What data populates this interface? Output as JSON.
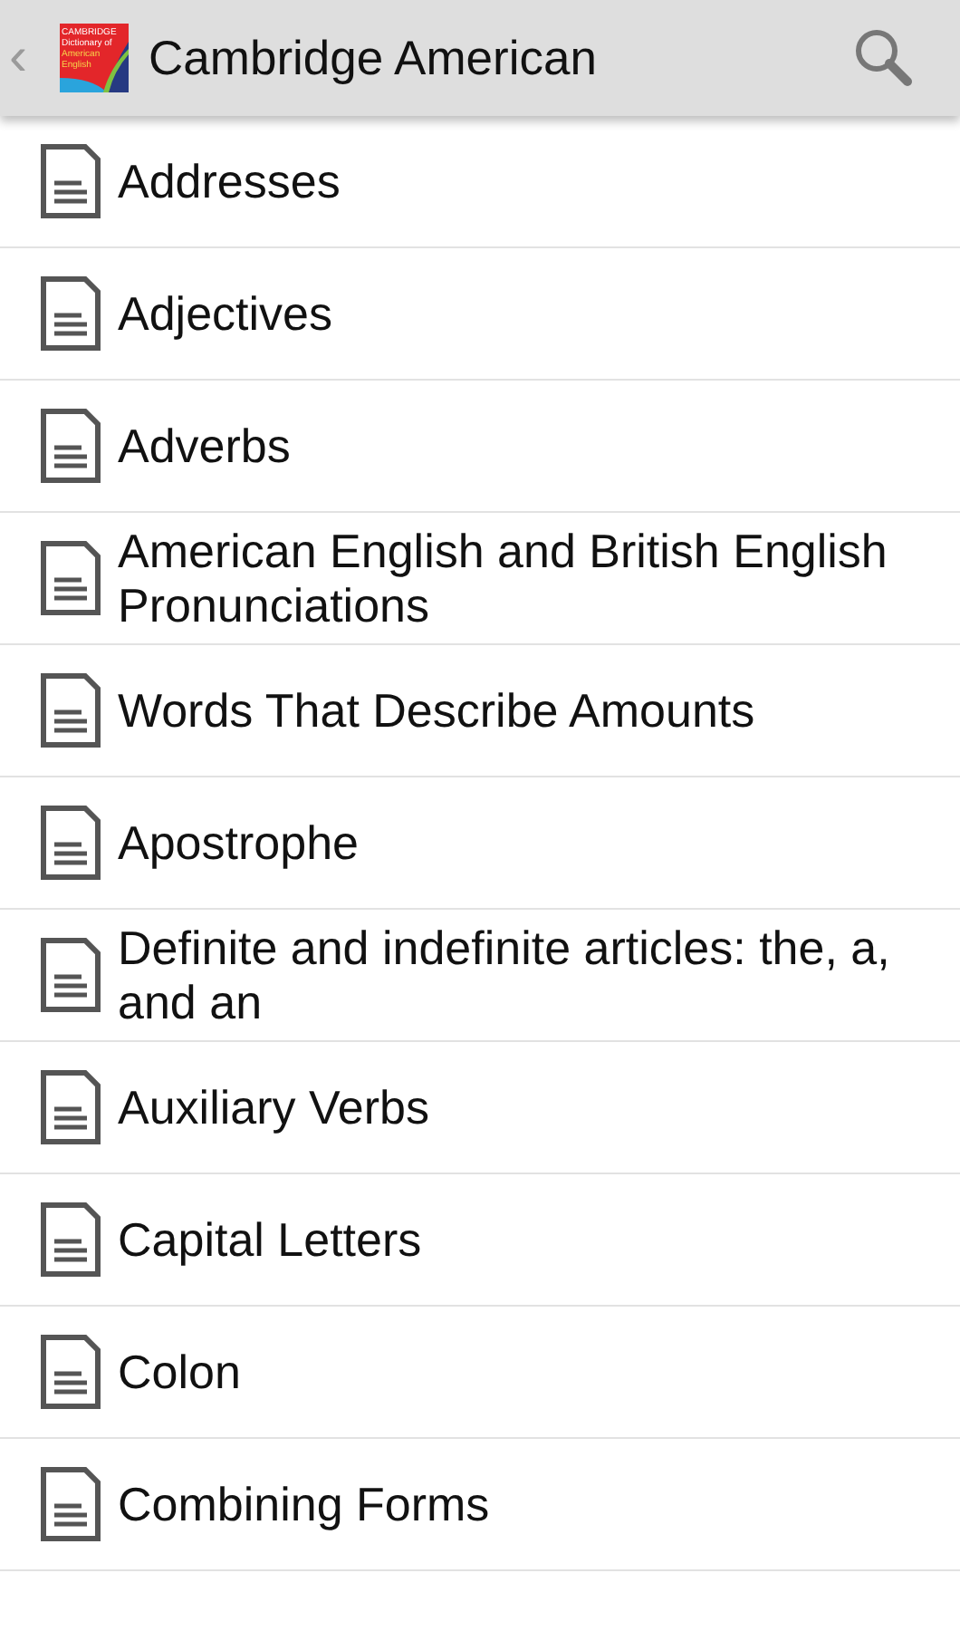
{
  "action_bar": {
    "back": "‹",
    "logo_lines": [
      "CAMBRIDGE",
      "Dictionary of",
      "American",
      "English"
    ],
    "title": "Cambridge American"
  },
  "items": [
    {
      "label": "Addresses"
    },
    {
      "label": "Adjectives"
    },
    {
      "label": "Adverbs"
    },
    {
      "label": "American English and British English Pronunciations"
    },
    {
      "label": "Words That Describe Amounts"
    },
    {
      "label": "Apostrophe"
    },
    {
      "label": "Definite and indefinite articles: the, a, and an"
    },
    {
      "label": "Auxiliary Verbs"
    },
    {
      "label": "Capital Letters"
    },
    {
      "label": "Colon"
    },
    {
      "label": "Combining Forms"
    }
  ]
}
